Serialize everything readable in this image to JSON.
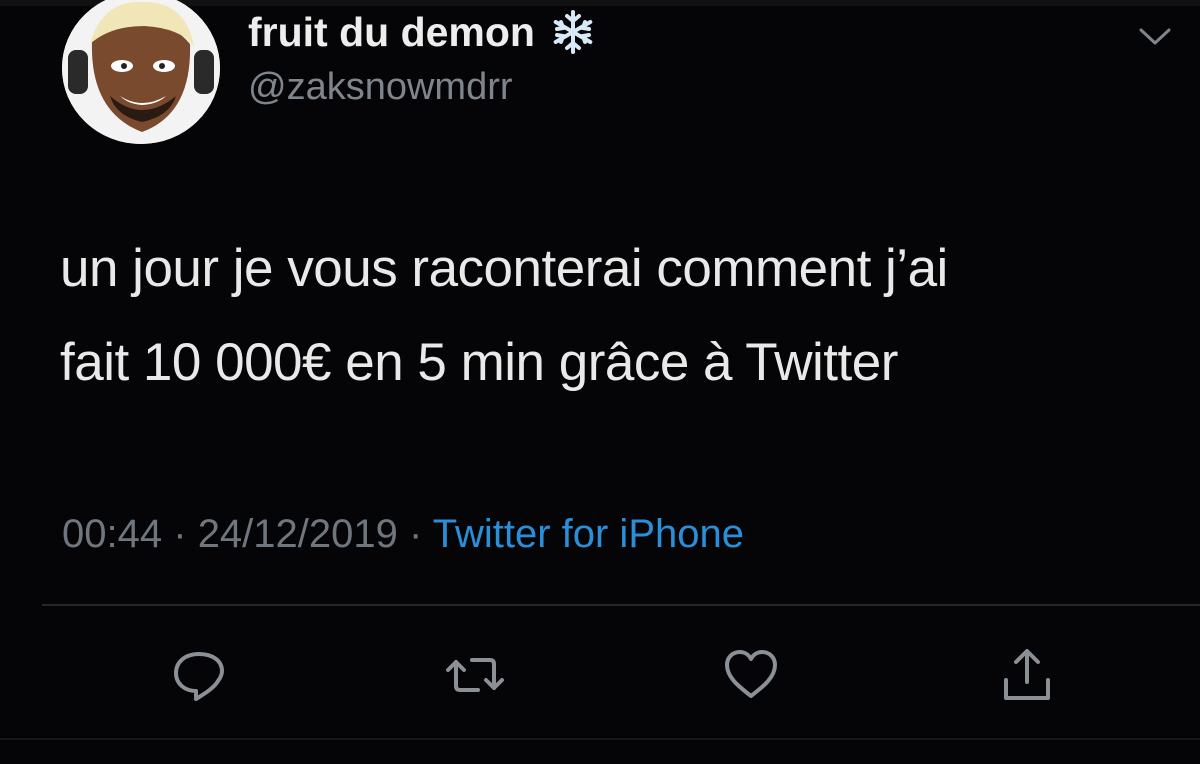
{
  "tweet": {
    "display_name": "fruit du demon",
    "name_emoji": "snowflake-icon",
    "handle": "@zaksnowmdrr",
    "text": "un jour je vous raconterai comment j’ai\nfait 10 000€ en 5 min grâce à Twitter",
    "time": "00:44",
    "date": "24/12/2019",
    "separator": "·",
    "source": "Twitter for iPhone"
  },
  "actions": {
    "reply_icon": "reply-icon",
    "retweet_icon": "retweet-icon",
    "like_icon": "heart-icon",
    "share_icon": "share-icon"
  },
  "colors": {
    "background": "#050507",
    "text": "#e9e9e9",
    "secondary": "#7e858c",
    "link": "#2a8fd8",
    "icon": "#8a9096"
  }
}
